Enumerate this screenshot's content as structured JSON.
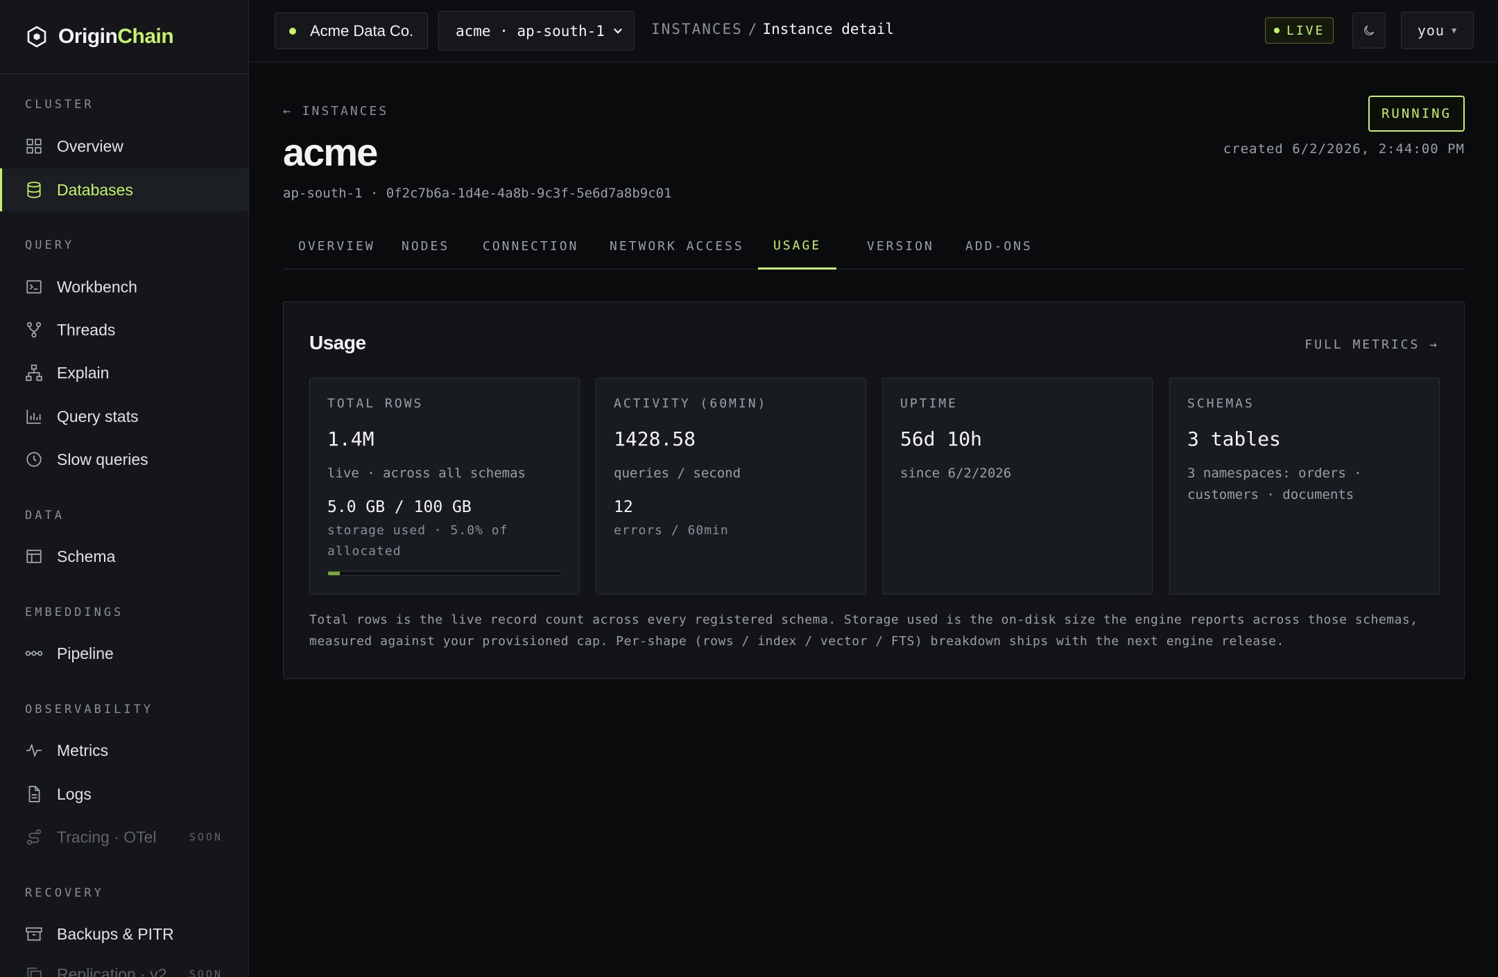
{
  "brand": {
    "name_a": "Origin",
    "name_b": "Chain",
    "accent": "#c6f26b"
  },
  "sidebar": {
    "sections": [
      {
        "label": "CLUSTER",
        "items": [
          {
            "label": "Overview",
            "icon": "grid-icon"
          },
          {
            "label": "Databases",
            "icon": "database-icon",
            "active": true
          }
        ]
      },
      {
        "label": "QUERY",
        "items": [
          {
            "label": "Workbench",
            "icon": "terminal-icon"
          },
          {
            "label": "Threads",
            "icon": "branch-icon"
          },
          {
            "label": "Explain",
            "icon": "hierarchy-icon"
          },
          {
            "label": "Query stats",
            "icon": "bar-chart-icon"
          },
          {
            "label": "Slow queries",
            "icon": "clock-icon"
          }
        ]
      },
      {
        "label": "DATA",
        "items": [
          {
            "label": "Schema",
            "icon": "table-icon"
          }
        ]
      },
      {
        "label": "EMBEDDINGS",
        "items": [
          {
            "label": "Pipeline",
            "icon": "pipeline-icon"
          }
        ]
      },
      {
        "label": "OBSERVABILITY",
        "items": [
          {
            "label": "Metrics",
            "icon": "pulse-icon"
          },
          {
            "label": "Logs",
            "icon": "file-icon"
          },
          {
            "label": "Tracing · OTel",
            "icon": "trace-icon",
            "badge": "SOON",
            "disabled": true
          }
        ]
      },
      {
        "label": "RECOVERY",
        "items": [
          {
            "label": "Backups & PITR",
            "icon": "archive-icon"
          },
          {
            "label": "Replication · v2",
            "icon": "copy-icon",
            "badge": "SOON",
            "disabled": true
          }
        ]
      }
    ]
  },
  "topbar": {
    "org": "Acme Data Co.",
    "region_select": "acme · ap-south-1",
    "breadcrumb_root": "INSTANCES",
    "breadcrumb_sep": "/",
    "breadcrumb_current": "Instance detail",
    "live": "LIVE",
    "user": "you"
  },
  "instance": {
    "back": "← INSTANCES",
    "name": "acme",
    "meta": "ap-south-1 · 0f2c7b6a-1d4e-4a8b-9c3f-5e6d7a8b9c01",
    "status": "RUNNING",
    "created": "created 6/2/2026, 2:44:00 PM"
  },
  "tabs": [
    {
      "label": "OVERVIEW"
    },
    {
      "label": "NODES"
    },
    {
      "label": "CONNECTION"
    },
    {
      "label": "NETWORK ACCESS"
    },
    {
      "label": "USAGE",
      "active": true
    },
    {
      "label": "VERSION"
    },
    {
      "label": "ADD-ONS"
    }
  ],
  "usage": {
    "title": "Usage",
    "full_metrics": "FULL METRICS →",
    "stats": [
      {
        "label": "TOTAL ROWS",
        "value": "1.4M",
        "sub": "live · across all schemas",
        "value2": "5.0 GB / 100 GB",
        "sub2": "storage used · 5.0% of allocated",
        "progress": 0.05
      },
      {
        "label": "ACTIVITY (60MIN)",
        "value": "1428.58",
        "sub": "queries / second",
        "value2": "12",
        "sub2": "errors / 60min"
      },
      {
        "label": "UPTIME",
        "value": "56d 10h",
        "sub": "since 6/2/2026"
      },
      {
        "label": "SCHEMAS",
        "value": "3 tables",
        "sub": "3 namespaces: orders · customers · documents"
      }
    ],
    "footnote": "Total rows is the live record count across every registered schema. Storage used is the on-disk size the engine reports across those schemas, measured against your provisioned cap. Per-shape (rows / index / vector / FTS) breakdown ships with the next engine release."
  }
}
